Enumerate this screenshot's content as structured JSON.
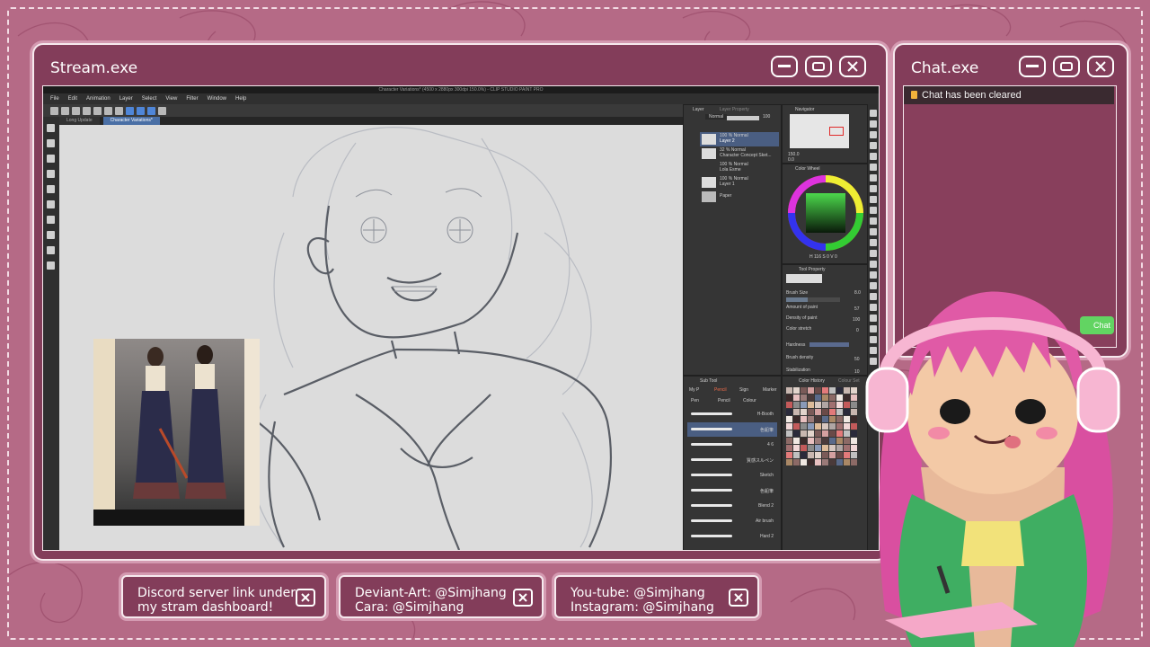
{
  "stream_window": {
    "title": "Stream.exe"
  },
  "chat_window": {
    "title": "Chat.exe",
    "message": "Chat has been cleared",
    "button_label": "Chat"
  },
  "app": {
    "title": "Character Variations* (4500 x 2880px 300dpi 150.0%) - CLIP STUDIO PAINT PRO",
    "menu": [
      "File",
      "Edit",
      "Animation",
      "Layer",
      "Select",
      "View",
      "Filter",
      "Window",
      "Help"
    ],
    "tabs": [
      "Long Update",
      "Character Variations*"
    ],
    "layer_panel": {
      "tabs": [
        "Layer",
        "Layer Property"
      ],
      "blend_mode": "Normal",
      "opacity": "100",
      "layers": [
        {
          "meta": "100 % Normal",
          "name": "Layer 2"
        },
        {
          "meta": "32 % Normal",
          "name": "Character Concept Sket..."
        },
        {
          "meta": "100 % Normal",
          "name": "Lola Esme"
        },
        {
          "meta": "100 % Normal",
          "name": "Layer 1"
        },
        {
          "meta": "",
          "name": "Paper"
        }
      ]
    },
    "navigator": {
      "title": "Navigator",
      "zoom": "150.0",
      "angle": "0.0"
    },
    "color_wheel": {
      "title": "Color Wheel",
      "readout": "H 116 S 0 V 0"
    },
    "tool_property": {
      "title": "Tool Property",
      "props": [
        {
          "label": "Brush Size",
          "value": "8.0"
        },
        {
          "label": "Amount of paint",
          "value": "57"
        },
        {
          "label": "Density of paint",
          "value": "100"
        },
        {
          "label": "Color stretch",
          "value": "0"
        },
        {
          "label": "Hardness",
          "value": ""
        },
        {
          "label": "Brush density",
          "value": "50"
        },
        {
          "label": "Stabilization",
          "value": "10"
        }
      ]
    },
    "sub_tool": {
      "title": "Sub Tool",
      "tabs": [
        "My P",
        "Pencil",
        "Sign",
        "Marker"
      ],
      "subtabs": [
        "Pen",
        "Pencil",
        "Colour"
      ],
      "brushes": [
        "H-Booth",
        "色鉛筆",
        "4 6",
        "質感スルペン",
        "Sketch",
        "色鉛筆",
        "Blend 2",
        "Air brush",
        "Hard 2"
      ]
    },
    "color_history": {
      "title": "Color History",
      "tab2": "Colour Set"
    }
  },
  "socials": [
    {
      "line1": "Discord server link under",
      "line2": "my stram dashboard!"
    },
    {
      "line1": "Deviant-Art: @Simjhang",
      "line2": "Cara: @Simjhang"
    },
    {
      "line1": "You-tube: @Simjhang",
      "line2": "Instagram: @Simjhang"
    }
  ],
  "colors": {
    "window": "#833d5a",
    "border": "#f6e9ee",
    "background": "#b56a86",
    "chat_button": "#62d462"
  }
}
